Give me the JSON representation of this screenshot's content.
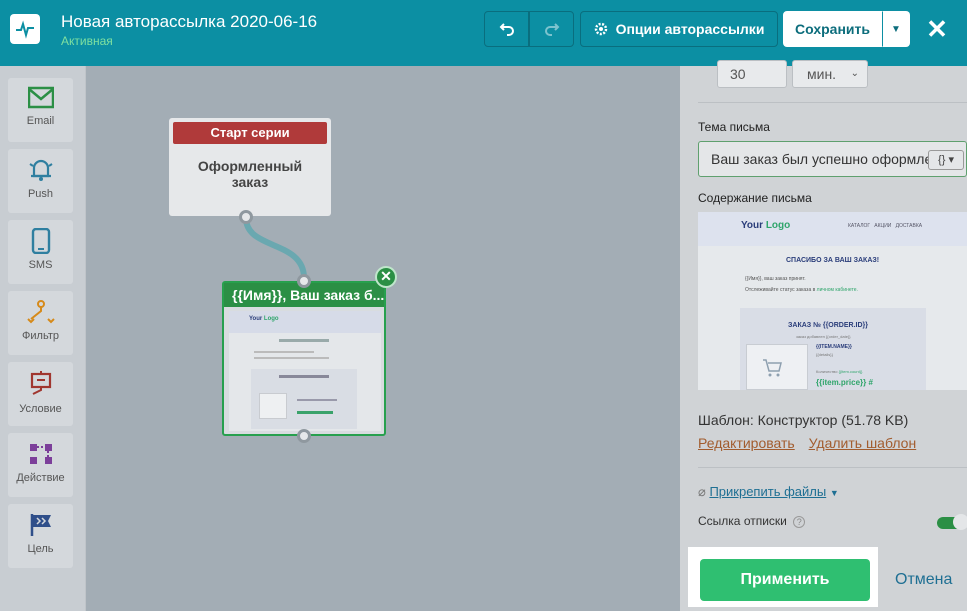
{
  "header": {
    "title": "Новая авторассылка 2020-06-16",
    "status": "Активная",
    "options_label": "Опции авторассылки",
    "save_label": "Сохранить"
  },
  "toolbar": {
    "items": [
      {
        "label": "Email",
        "icon": "envelope-icon"
      },
      {
        "label": "Push",
        "icon": "bell-icon"
      },
      {
        "label": "SMS",
        "icon": "phone-icon"
      },
      {
        "label": "Фильтр",
        "icon": "filter-icon"
      },
      {
        "label": "Условие",
        "icon": "condition-icon"
      },
      {
        "label": "Действие",
        "icon": "action-icon"
      },
      {
        "label": "Цель",
        "icon": "flag-icon"
      }
    ]
  },
  "canvas": {
    "start_node": {
      "head": "Старт серии",
      "body": "Оформленный заказ"
    },
    "email_node": {
      "head": "{{Имя}}, Ваш заказ б..."
    }
  },
  "panel": {
    "delay_value": "30",
    "delay_unit": "мин.",
    "subject_label": "Тема письма",
    "subject_value": "Ваш заказ был успешно оформлен",
    "var_button": "{}",
    "content_label": "Содержание письма",
    "preview": {
      "logo_a": "Your",
      "logo_b": "Logo",
      "nav": [
        "КАТАЛОГ",
        "АКЦИИ",
        "ДОСТАВКА"
      ],
      "heading": "СПАСИБО ЗА ВАШ ЗАКАЗ!",
      "line1": "{{Имя}}, ваш заказ принят.",
      "line2": "Отслеживайте статус заказа в",
      "line2_link": "личном кабинете.",
      "order_title": "ЗАКАЗ № {{ORDER.ID}}",
      "order_sub": "заказ добавлен {{order_date}}",
      "item_name": "{{ITEM.NAME}}",
      "item_meta": "{{details}}",
      "qty_label": "Количество",
      "qty_value": "{{item.count}}",
      "price": "{{item.price}} #"
    },
    "template_info": "Шаблон: Конструктор (51.78 KB)",
    "edit_link": "Редактировать",
    "delete_link": "Удалить шаблон",
    "attach_label": "Прикрепить файлы",
    "unsub_label": "Ссылка отписки",
    "apply_label": "Применить",
    "cancel_label": "Отмена"
  }
}
